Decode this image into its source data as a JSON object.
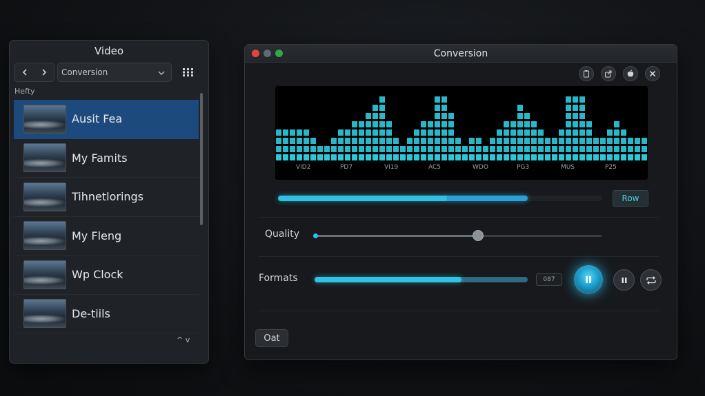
{
  "left_panel": {
    "title": "Video",
    "nav": {
      "back_icon": "chevron-left-icon",
      "forward_icon": "chevron-right-icon"
    },
    "dropdown": {
      "value": "Conversion"
    },
    "grid_icon": "grid-icon",
    "section_label": "Hefty",
    "files": [
      {
        "name": "Ausit Fea",
        "selected": true
      },
      {
        "name": "My Famits",
        "selected": false
      },
      {
        "name": "Tihnetlorings",
        "selected": false
      },
      {
        "name": "My Fleng",
        "selected": false
      },
      {
        "name": "Wp Clock",
        "selected": false
      },
      {
        "name": "De-tiils",
        "selected": false
      }
    ],
    "sort_arrows": "^ v"
  },
  "window": {
    "title": "Conversion",
    "tool_icons": [
      "clipboard-icon",
      "share-icon",
      "apple-icon",
      "close-icon"
    ],
    "spectrum": {
      "color": "#2fd2e6",
      "bar_levels": [
        4,
        4,
        4,
        4,
        4,
        3,
        2,
        2,
        3,
        4,
        4,
        5,
        5,
        6,
        7,
        8,
        5,
        3,
        2,
        3,
        4,
        5,
        5,
        8,
        8,
        6,
        3,
        2,
        3,
        3,
        2,
        3,
        4,
        5,
        5,
        7,
        6,
        5,
        4,
        3,
        3,
        4,
        8,
        8,
        8,
        5,
        3,
        3,
        4,
        5,
        4,
        3,
        3,
        3
      ],
      "labels": [
        "VID2",
        "PD7",
        "VI19",
        "AC5",
        "WDO",
        "PG3",
        "MUS",
        "P25"
      ]
    },
    "progress": {
      "value": 0.77,
      "light_portion": 0.52
    },
    "row_button_label": "Row",
    "quality": {
      "label": "Quality",
      "value": 0.57
    },
    "formats": {
      "label": "Formats",
      "value": 0.69,
      "chip": "087"
    },
    "controls": {
      "play_icon": "pause-icon",
      "pause_icon": "pause-icon",
      "loop_icon": "repeat-icon"
    },
    "footer_button_label": "Oat"
  },
  "colors": {
    "accent": "#2fc0e3",
    "selection": "#1c4a7d"
  }
}
